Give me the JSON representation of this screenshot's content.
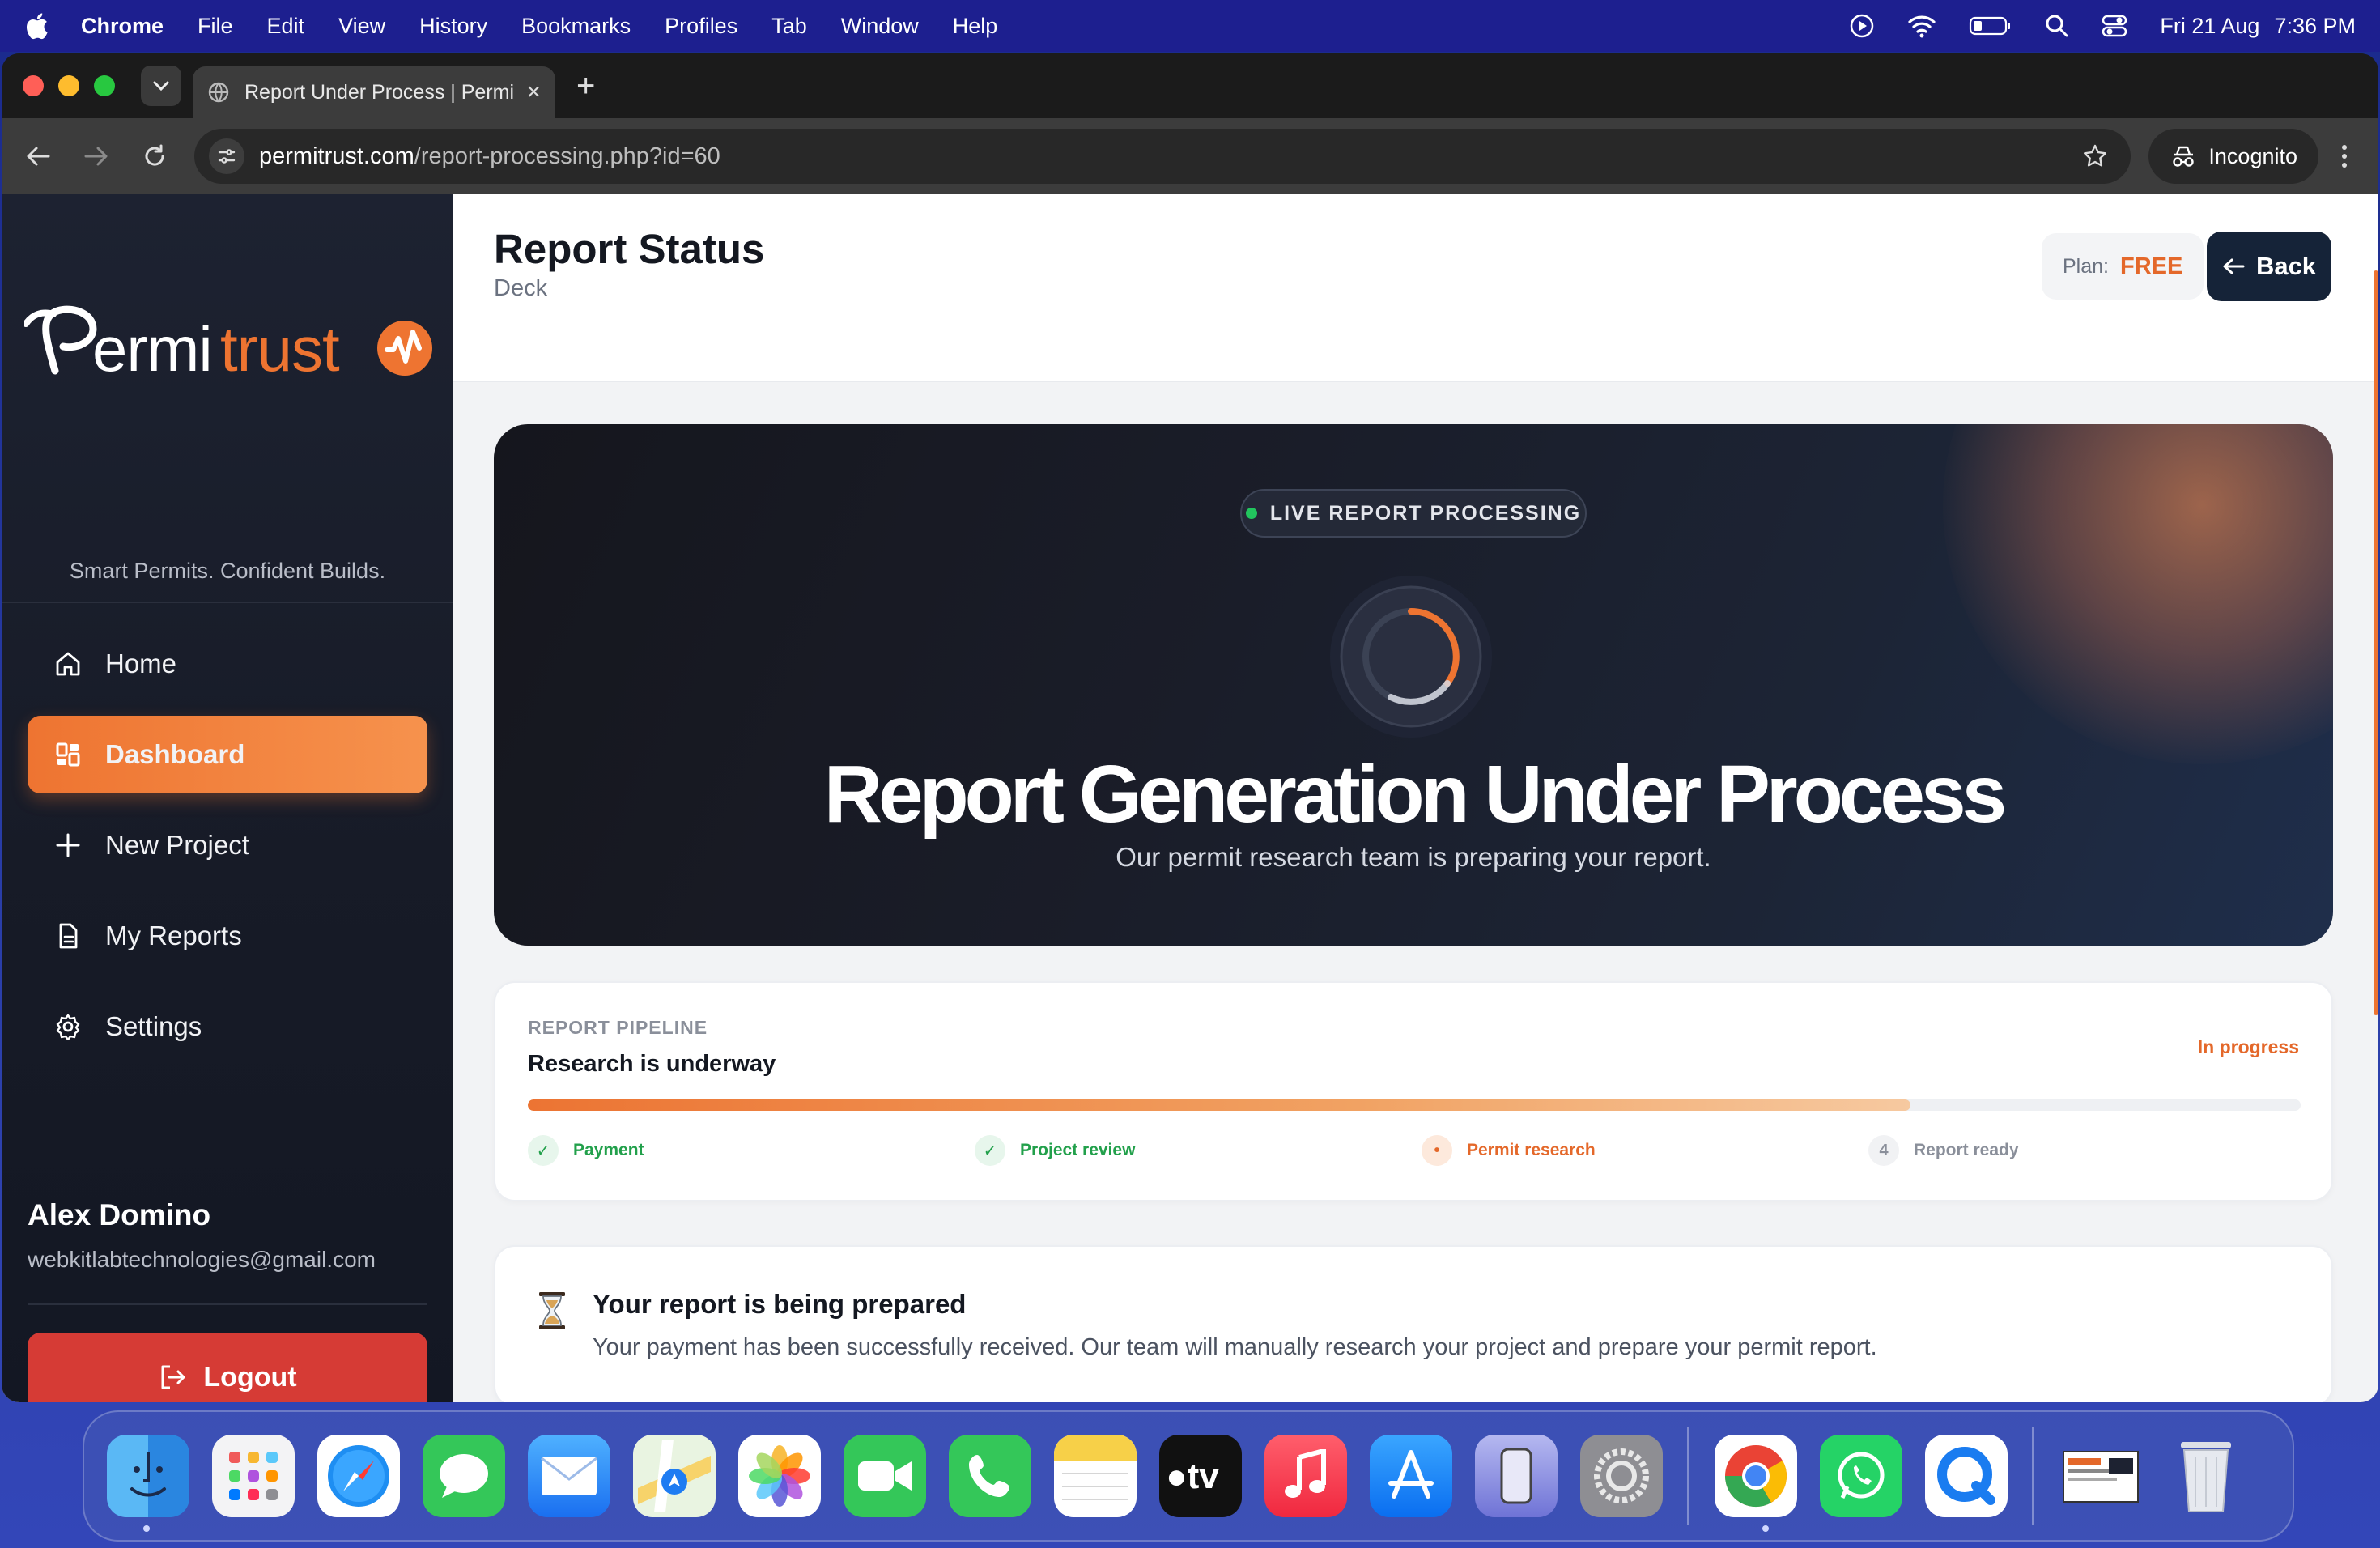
{
  "menubar": {
    "app": "Chrome",
    "items": [
      "File",
      "Edit",
      "View",
      "History",
      "Bookmarks",
      "Profiles",
      "Tab",
      "Window",
      "Help"
    ],
    "date": "Fri 21 Aug",
    "time": "7:36 PM"
  },
  "browser": {
    "tab_title": "Report Under Process | Permi",
    "url_host": "permitrust.com",
    "url_path": "/report-processing.php?id=60",
    "incognito_label": "Incognito"
  },
  "sidebar": {
    "brand": "Permitrust",
    "tagline": "Smart Permits. Confident Builds.",
    "nav": [
      {
        "label": "Home",
        "icon": "home-icon"
      },
      {
        "label": "Dashboard",
        "icon": "dashboard-icon"
      },
      {
        "label": "New Project",
        "icon": "plus-icon"
      },
      {
        "label": "My Reports",
        "icon": "document-icon"
      },
      {
        "label": "Settings",
        "icon": "gear-icon"
      }
    ],
    "active_index": 1,
    "user_name": "Alex Domino",
    "user_email": "webkitlabtechnologies@gmail.com",
    "logout_label": "Logout"
  },
  "header": {
    "title": "Report Status",
    "subtitle": "Deck",
    "plan_label": "Plan:",
    "plan_value": "FREE",
    "back_label": "Back"
  },
  "hero": {
    "badge": "LIVE REPORT PROCESSING",
    "title": "Report Generation Under Process",
    "subtitle": "Our permit research team is preparing your report."
  },
  "pipeline": {
    "label": "REPORT PIPELINE",
    "title": "Research is underway",
    "status": "In progress",
    "progress": 0.78,
    "steps": [
      {
        "label": "Payment",
        "state": "done",
        "marker": "✓"
      },
      {
        "label": "Project review",
        "state": "done",
        "marker": "✓"
      },
      {
        "label": "Permit research",
        "state": "active",
        "marker": "•"
      },
      {
        "label": "Report ready",
        "state": "pending",
        "marker": "4"
      }
    ]
  },
  "notice": {
    "title": "Your report is being prepared",
    "text": "Your payment has been successfully received. Our team will manually research your project and prepare your permit report."
  },
  "colors": {
    "accent": "#ee7431",
    "navy": "#152338",
    "danger": "#d63b35",
    "success": "#22a04b"
  },
  "dock": [
    "Finder",
    "Launchpad",
    "Safari",
    "Messages",
    "Mail",
    "Maps",
    "Photos",
    "FaceTime",
    "Phone",
    "Notes",
    "TV",
    "Music",
    "App Store",
    "iPhone Mirroring",
    "System Settings",
    "Chrome",
    "WhatsApp",
    "QuickTime",
    "Downloads",
    "Trash"
  ]
}
